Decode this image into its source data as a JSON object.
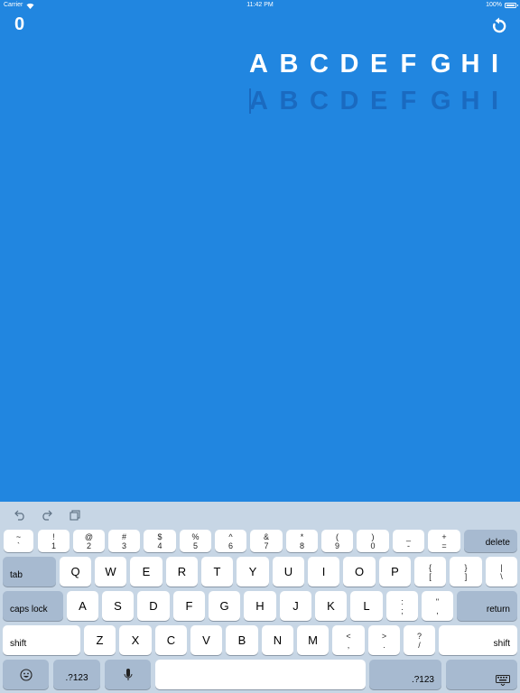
{
  "status_bar": {
    "carrier": "Carrier",
    "time": "11:42 PM",
    "battery": "100%"
  },
  "game": {
    "score": "0",
    "target_letters": [
      "A",
      "B",
      "C",
      "D",
      "E",
      "F",
      "G",
      "H",
      "I"
    ],
    "typed_letters": [
      "A",
      "B",
      "C",
      "D",
      "E",
      "F",
      "G",
      "H",
      "I"
    ]
  },
  "colors": {
    "background": "#2186e0",
    "target_text": "#ffffff",
    "typed_text": "#1a6ac0",
    "keyboard_bg": "#c7d6e5",
    "key_bg": "#ffffff",
    "fn_key_bg": "#a7bad0"
  },
  "keyboard": {
    "shortcuts": [
      "undo-icon",
      "redo-icon",
      "paste-icon"
    ],
    "number_row": [
      {
        "top": "~",
        "bottom": "`"
      },
      {
        "top": "!",
        "bottom": "1"
      },
      {
        "top": "@",
        "bottom": "2"
      },
      {
        "top": "#",
        "bottom": "3"
      },
      {
        "top": "$",
        "bottom": "4"
      },
      {
        "top": "%",
        "bottom": "5"
      },
      {
        "top": "^",
        "bottom": "6"
      },
      {
        "top": "&",
        "bottom": "7"
      },
      {
        "top": "*",
        "bottom": "8"
      },
      {
        "top": "(",
        "bottom": "9"
      },
      {
        "top": ")",
        "bottom": "0"
      },
      {
        "top": "_",
        "bottom": "-"
      },
      {
        "top": "+",
        "bottom": "="
      }
    ],
    "delete": "delete",
    "tab": "tab",
    "row_q": [
      "Q",
      "W",
      "E",
      "R",
      "T",
      "Y",
      "U",
      "I",
      "O",
      "P"
    ],
    "row_q_symbols": [
      {
        "top": "{",
        "bottom": "["
      },
      {
        "top": "}",
        "bottom": "]"
      },
      {
        "top": "|",
        "bottom": "\\"
      }
    ],
    "caps_lock": "caps lock",
    "row_a": [
      "A",
      "S",
      "D",
      "F",
      "G",
      "H",
      "J",
      "K",
      "L"
    ],
    "row_a_symbols": [
      {
        "top": ":",
        "bottom": ";"
      },
      {
        "top": "\"",
        "bottom": ","
      }
    ],
    "return": "return",
    "shift_left": "shift",
    "row_z": [
      "Z",
      "X",
      "C",
      "V",
      "B",
      "N",
      "M"
    ],
    "row_z_symbols": [
      {
        "top": "<",
        "bottom": ","
      },
      {
        "top": ">",
        "bottom": "."
      },
      {
        "top": "?",
        "bottom": "/"
      }
    ],
    "shift_right": "shift",
    "numbers_left": ".?123",
    "numbers_right": ".?123"
  }
}
